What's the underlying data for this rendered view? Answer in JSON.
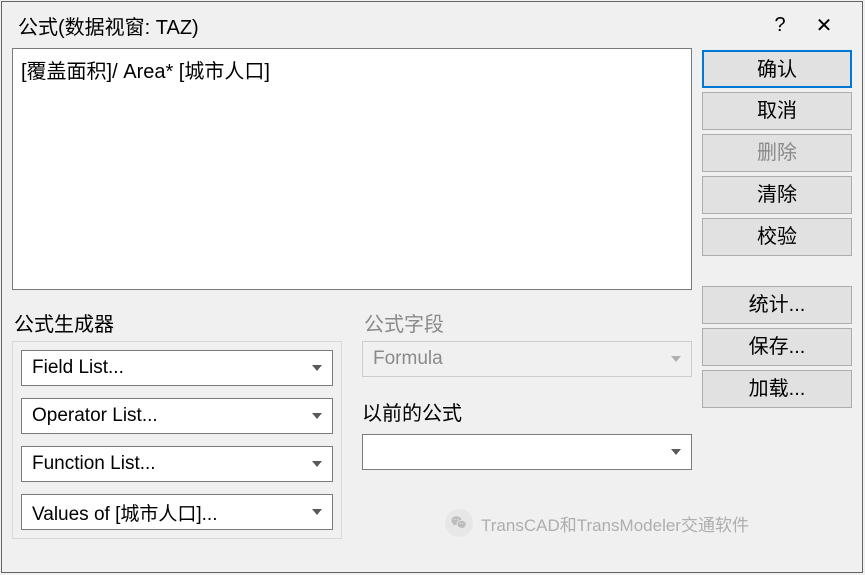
{
  "title": "公式(数据视窗: TAZ)",
  "formula_text": "[覆盖面积]/ Area* [城市人口]",
  "buttons": {
    "ok": "确认",
    "cancel": "取消",
    "delete": "删除",
    "clear": "清除",
    "verify": "校验",
    "stats": "统计...",
    "save": "保存...",
    "load": "加载..."
  },
  "builder": {
    "label": "公式生成器",
    "field_list": "Field List...",
    "operator_list": "Operator List...",
    "function_list": "Function List...",
    "values_of": "Values of [城市人口]..."
  },
  "fields": {
    "label": "公式字段",
    "value": "Formula"
  },
  "previous": {
    "label": "以前的公式",
    "value": ""
  },
  "watermark": "TransCAD和TransModeler交通软件"
}
